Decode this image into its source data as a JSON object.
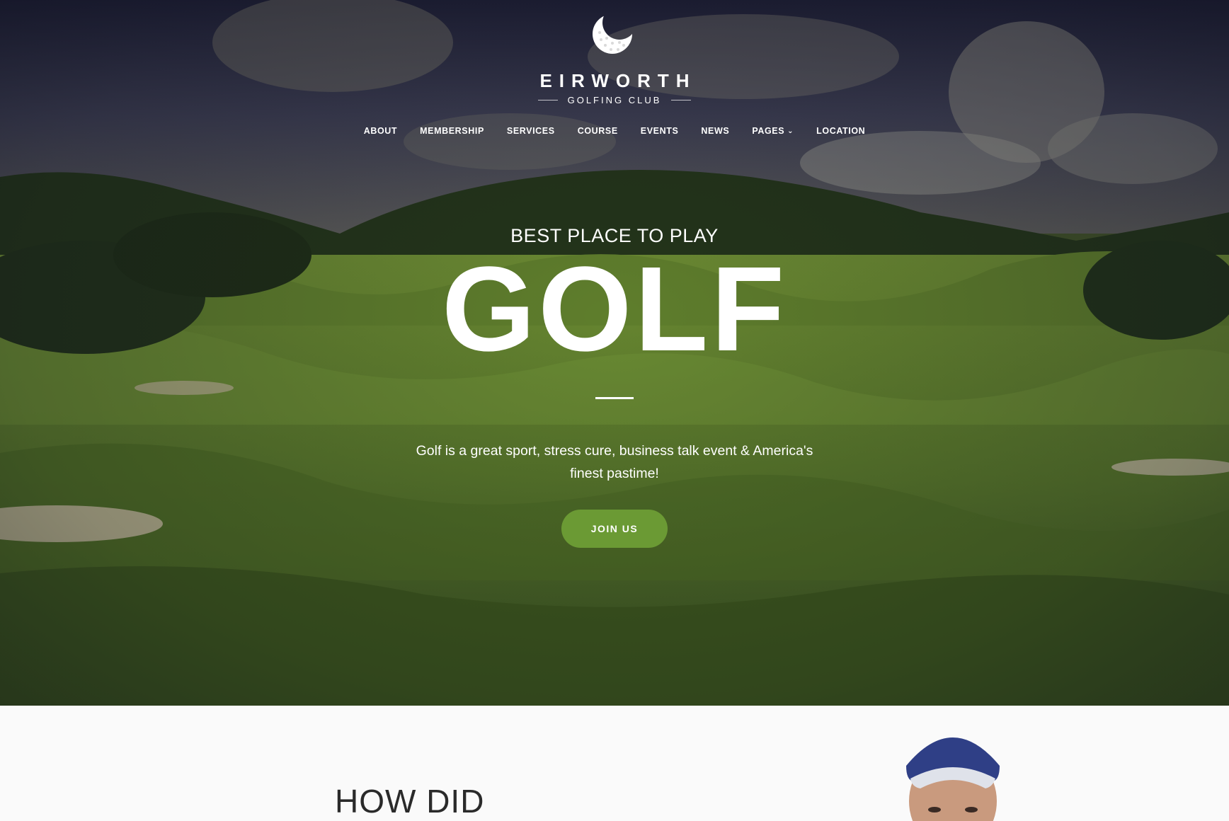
{
  "brand": {
    "name": "EIRWORTH",
    "subtitle": "GOLFING CLUB"
  },
  "nav": {
    "items": [
      {
        "label": "ABOUT"
      },
      {
        "label": "MEMBERSHIP"
      },
      {
        "label": "SERVICES"
      },
      {
        "label": "COURSE"
      },
      {
        "label": "EVENTS"
      },
      {
        "label": "NEWS"
      },
      {
        "label": "PAGES",
        "has_dropdown": true
      },
      {
        "label": "LOCATION"
      }
    ]
  },
  "hero": {
    "kicker": "BEST PLACE TO PLAY",
    "headline": "GOLF",
    "tagline": "Golf is a great sport, stress cure, business talk event & America's finest pastime!",
    "cta_label": "JOIN US"
  },
  "section": {
    "title": "HOW DID"
  },
  "colors": {
    "accent": "#6b9a34",
    "text_light": "#ffffff",
    "text_dark": "#2a2a2a"
  },
  "icons": {
    "logo": "golf-ball-crescent-icon",
    "dropdown": "chevron-down-icon"
  }
}
